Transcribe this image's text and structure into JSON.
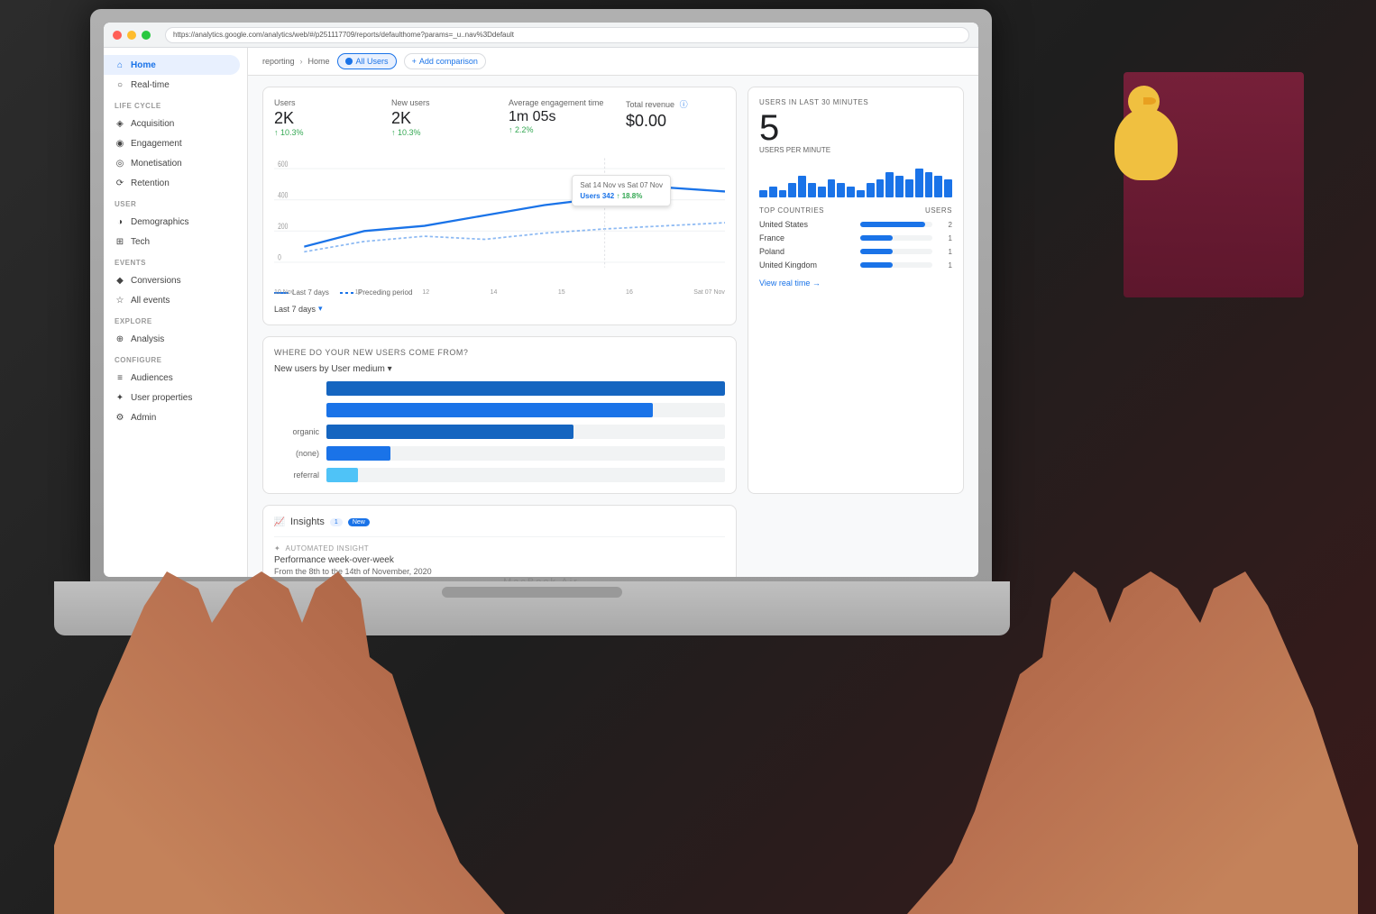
{
  "scene": {
    "laptop_brand": "MacBook Air",
    "url": "https://analytics.google.com/analytics/web/#/p251117709/reports/defaulthome?params=_u..nav%3Ddefault"
  },
  "browser": {
    "url_text": "https://analytics.google.com/analytics/web/#/p251117709/reports/defaulthome?params=_u..nav%3Ddefault"
  },
  "topbar": {
    "reporting_label": "reporting",
    "breadcrumb_home": "Home",
    "all_users_label": "All Users",
    "add_comparison_label": "Add comparison"
  },
  "sidebar": {
    "sections": [
      {
        "label": "",
        "items": [
          {
            "id": "home",
            "label": "Home",
            "active": true
          },
          {
            "id": "realtime",
            "label": "Real-time"
          }
        ]
      },
      {
        "label": "LIFE CYCLE",
        "items": [
          {
            "id": "acquisition",
            "label": "Acquisition"
          },
          {
            "id": "engagement",
            "label": "Engagement"
          },
          {
            "id": "monetisation",
            "label": "Monetisation"
          },
          {
            "id": "retention",
            "label": "Retention"
          }
        ]
      },
      {
        "label": "USER",
        "items": [
          {
            "id": "demographics",
            "label": "Demographics"
          },
          {
            "id": "tech",
            "label": "Tech"
          }
        ]
      },
      {
        "label": "EVENTS",
        "items": [
          {
            "id": "conversions",
            "label": "Conversions"
          },
          {
            "id": "allevents",
            "label": "All events"
          }
        ]
      },
      {
        "label": "EXPLORE",
        "items": [
          {
            "id": "analysis",
            "label": "Analysis"
          }
        ]
      },
      {
        "label": "CONFIGURE",
        "items": [
          {
            "id": "audiences",
            "label": "Audiences"
          },
          {
            "id": "userprops",
            "label": "User properties"
          },
          {
            "id": "admin",
            "label": "Admin"
          }
        ]
      }
    ]
  },
  "metrics": {
    "users": {
      "label": "Users",
      "value": "2K",
      "change": "10.3%",
      "change_dir": "up"
    },
    "new_users": {
      "label": "New users",
      "value": "2K",
      "change": "10.3%",
      "change_dir": "up"
    },
    "avg_engagement": {
      "label": "Average engagement time",
      "value": "1m 05s",
      "change": "2.2%",
      "change_dir": "up"
    },
    "total_revenue": {
      "label": "Total revenue",
      "value": "$0.00"
    }
  },
  "chart": {
    "legend_last7": "Last 7 days",
    "legend_preceding": "Preceding period",
    "date_selector": "Last 7 days",
    "x_labels": [
      "10 Nov",
      "",
      "",
      "14",
      "",
      "",
      "Sat 07 Nov"
    ],
    "tooltip": {
      "date": "Sat 14 Nov vs Sat 07 Nov",
      "value": "342",
      "change": "18.8%",
      "change_dir": "up"
    }
  },
  "realtime": {
    "section_label": "USERS IN LAST 30 MINUTES",
    "value": "5",
    "per_minute_label": "USERS PER MINUTE",
    "bars": [
      2,
      3,
      2,
      4,
      6,
      4,
      3,
      5,
      4,
      3,
      2,
      4,
      5,
      7,
      6,
      5,
      8,
      7,
      6,
      5
    ],
    "countries_label": "TOP COUNTRIES",
    "users_label": "USERS",
    "countries": [
      {
        "name": "United States",
        "count": 2,
        "pct": 90
      },
      {
        "name": "France",
        "count": 1,
        "pct": 45
      },
      {
        "name": "Poland",
        "count": 1,
        "pct": 45
      },
      {
        "name": "United Kingdom",
        "count": 1,
        "pct": 45
      }
    ],
    "view_realtime": "View real time →"
  },
  "new_users_section": {
    "section_title": "WHERE DO YOUR NEW USERS COME FROM?",
    "chart_title": "New users by User medium ▾",
    "bars": [
      {
        "label": "",
        "value": 100,
        "type": "dark"
      },
      {
        "label": "",
        "value": 80,
        "type": "med"
      },
      {
        "label": "organic",
        "value": 60,
        "type": "dark"
      },
      {
        "label": "(none)",
        "value": 15,
        "type": "med"
      },
      {
        "label": "referral",
        "value": 8,
        "type": "light"
      }
    ]
  },
  "insights": {
    "title": "Insights",
    "count": "1",
    "new_badge": "New",
    "automated_label": "AUTOMATED INSIGHT",
    "insight_title": "Performance week-over-week",
    "insight_desc": "From the 8th to the 14th of November, 2020"
  }
}
